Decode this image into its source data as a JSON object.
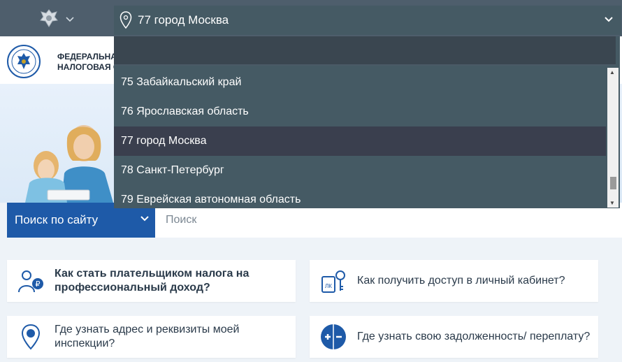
{
  "region": {
    "selected": "77 город Москва"
  },
  "header": {
    "org_title": "ФЕДЕРАЛЬНА\nНАЛОГОВАЯ С"
  },
  "dropdown": {
    "filter_value": "",
    "items": [
      "75 Забайкальский край",
      "76 Ярославская область",
      "77 город Москва",
      "78 Санкт-Петербург",
      "79 Еврейская автономная область"
    ],
    "active_index": 2,
    "scroll_position": 0.9
  },
  "search": {
    "scope_label": "Поиск по сайту",
    "placeholder": "Поиск"
  },
  "cards": [
    {
      "text": "Как стать плательщиком налога на профессиональный доход?",
      "icon": "self-employed-icon"
    },
    {
      "text": "Как получить доступ в личный кабинет?",
      "icon": "lk-keys-icon"
    },
    {
      "text": "Где узнать адрес и реквизиты моей инспекции?",
      "icon": "location-pin-icon"
    },
    {
      "text": "Где узнать свою задолженность/ переплату?",
      "icon": "plus-minus-icon"
    }
  ],
  "colors": {
    "topbar": "#4e5e6c",
    "dropdown": "#455a64",
    "active_item": "#3a3f4e",
    "search_scope": "#1e5aa8"
  }
}
